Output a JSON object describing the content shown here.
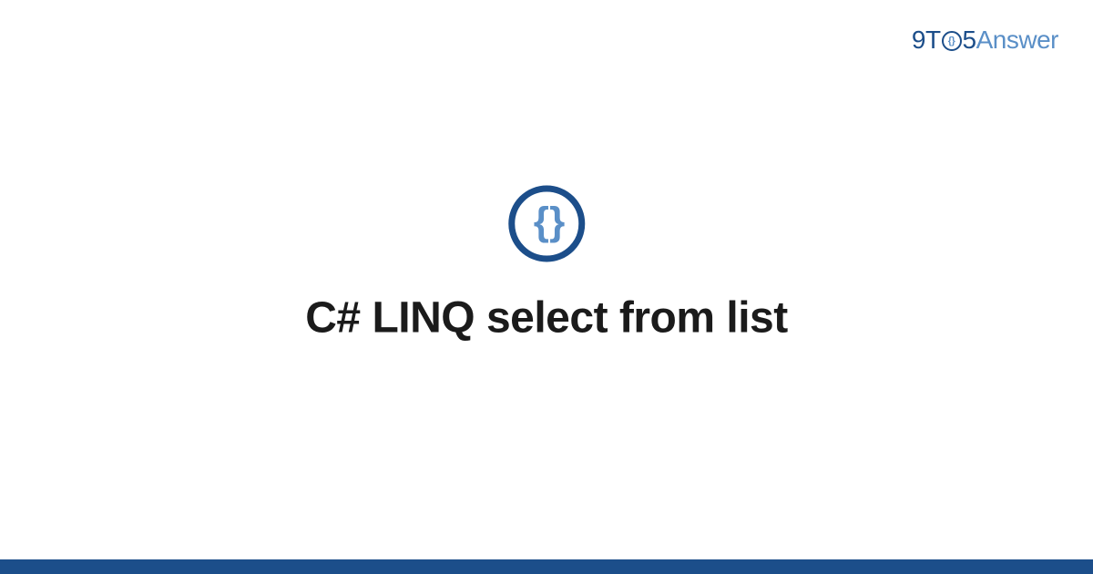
{
  "brand": {
    "nine": "9",
    "t": "T",
    "o_inner": "{}",
    "five": "5",
    "answer": "Answer"
  },
  "icon": {
    "braces": "{ }"
  },
  "title": "C# LINQ select from list",
  "colors": {
    "primary": "#1c4e8a",
    "accent": "#5a8fc7",
    "text": "#1b1b1b",
    "background": "#ffffff"
  }
}
